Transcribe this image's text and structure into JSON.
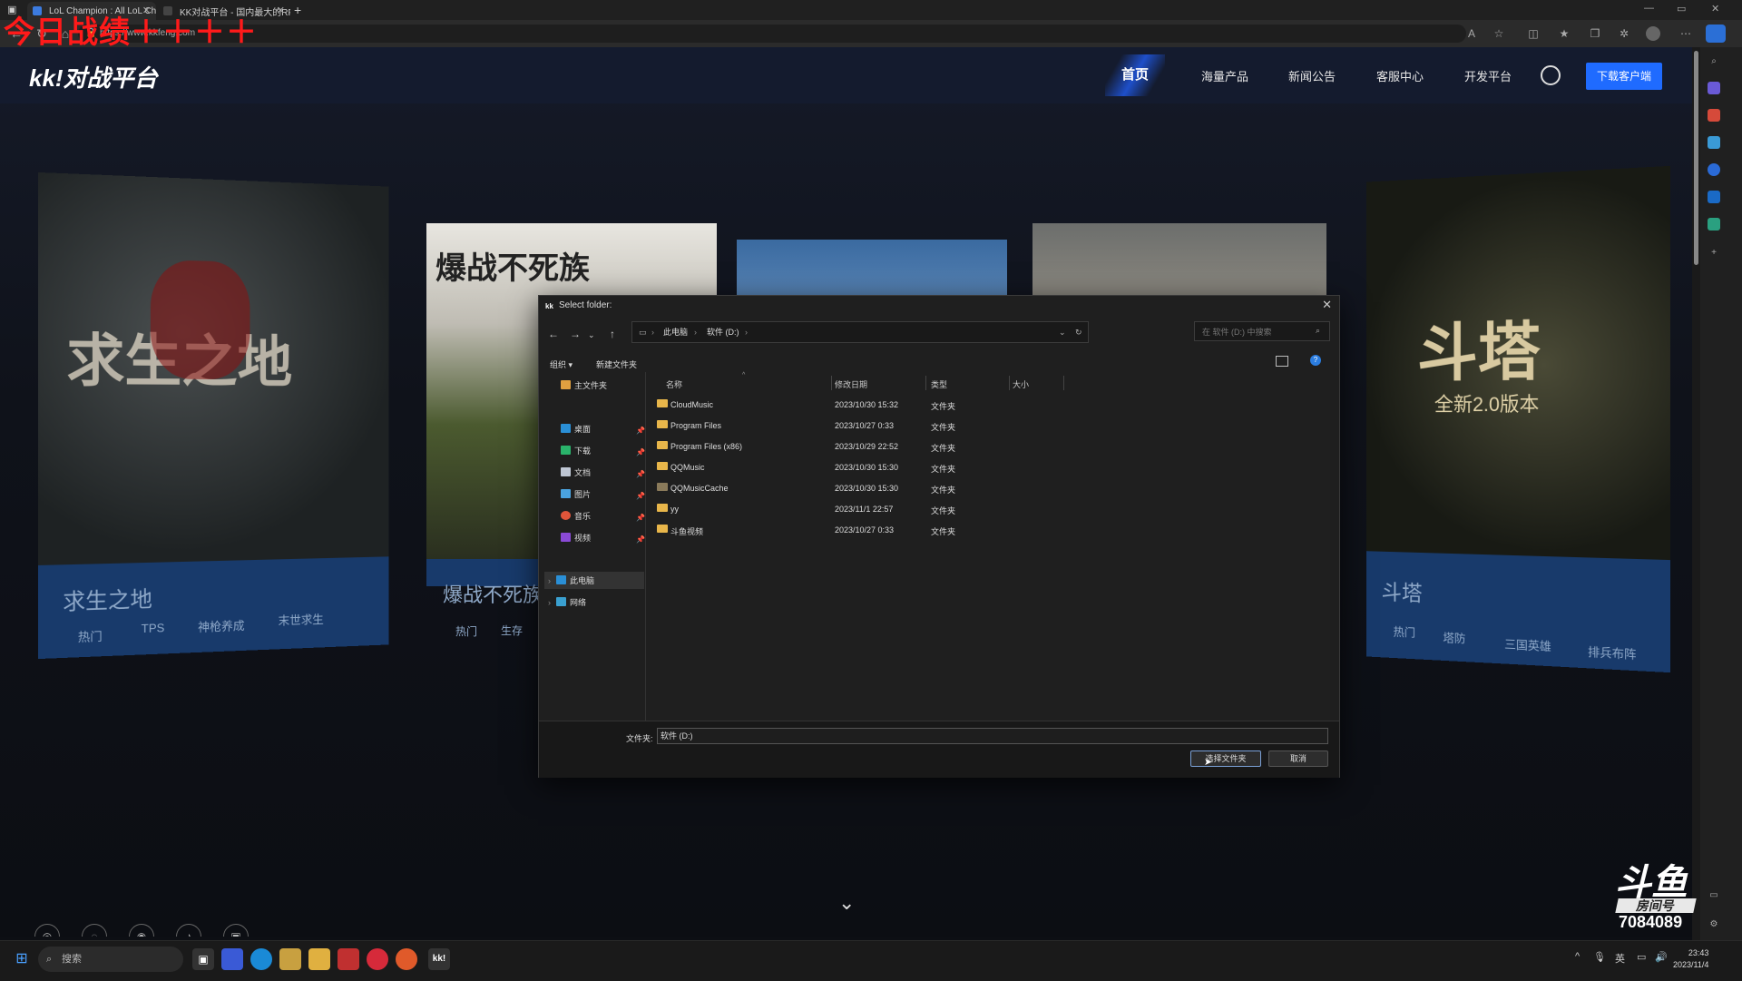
{
  "watermark": "今日战绩＋＋＋＋",
  "browser": {
    "tabs": [
      {
        "label": "LoL Champion : All LoL Champio"
      },
      {
        "label": "KK对战平台 - 国内最大的RPG开"
      }
    ],
    "url": "https://www.kkfeng.com"
  },
  "site": {
    "logo": "kk!对战平台",
    "nav": {
      "home": "首页",
      "products": "海量产品",
      "news": "新闻公告",
      "support": "客服中心",
      "dev": "开发平台"
    },
    "download_label": "下载客户端",
    "cards": [
      {
        "title": "求生之地",
        "tags": [
          "热门",
          "TPS",
          "神枪养成",
          "末世求生"
        ],
        "art": "求生之地"
      },
      {
        "title": "爆战不死族",
        "tags": [
          "热门",
          "生存"
        ],
        "art": "爆战不死族"
      },
      {
        "title": "斗塔",
        "tags": [
          "热门",
          "塔防",
          "三国英雄",
          "排兵布阵"
        ],
        "art": "斗塔"
      }
    ],
    "art_subtitle": "全新2.0版本"
  },
  "dialog": {
    "title": "Select folder:",
    "breadcrumb": [
      "此电脑",
      "软件 (D:)"
    ],
    "search_placeholder": "在 软件 (D:) 中搜索",
    "commands": {
      "organize": "组织 ▾",
      "new_folder": "新建文件夹"
    },
    "sidebar": {
      "home": "主文件夹",
      "quick": [
        "桌面",
        "下载",
        "文档",
        "图片",
        "音乐",
        "视频"
      ],
      "pc": "此电脑",
      "network": "网络"
    },
    "columns": {
      "name": "名称",
      "modified": "修改日期",
      "type": "类型",
      "size": "大小"
    },
    "files": [
      {
        "name": "CloudMusic",
        "modified": "2023/10/30 15:32",
        "type": "文件夹"
      },
      {
        "name": "Program Files",
        "modified": "2023/10/27 0:33",
        "type": "文件夹"
      },
      {
        "name": "Program Files (x86)",
        "modified": "2023/10/29 22:52",
        "type": "文件夹"
      },
      {
        "name": "QQMusic",
        "modified": "2023/10/30 15:30",
        "type": "文件夹"
      },
      {
        "name": "QQMusicCache",
        "modified": "2023/10/30 15:30",
        "type": "文件夹"
      },
      {
        "name": "yy",
        "modified": "2023/11/1 22:57",
        "type": "文件夹"
      },
      {
        "name": "斗鱼视频",
        "modified": "2023/10/27 0:33",
        "type": "文件夹"
      }
    ],
    "folder_label": "文件夹:",
    "folder_value": "软件 (D:)",
    "select_button": "选择文件夹",
    "cancel_button": "取消"
  },
  "taskbar": {
    "search": "搜索",
    "time": "23:43",
    "date": "2023/11/4",
    "ime": "英"
  },
  "douyu": {
    "brand": "斗鱼",
    "room_label": "房间号",
    "room": "7084089"
  }
}
